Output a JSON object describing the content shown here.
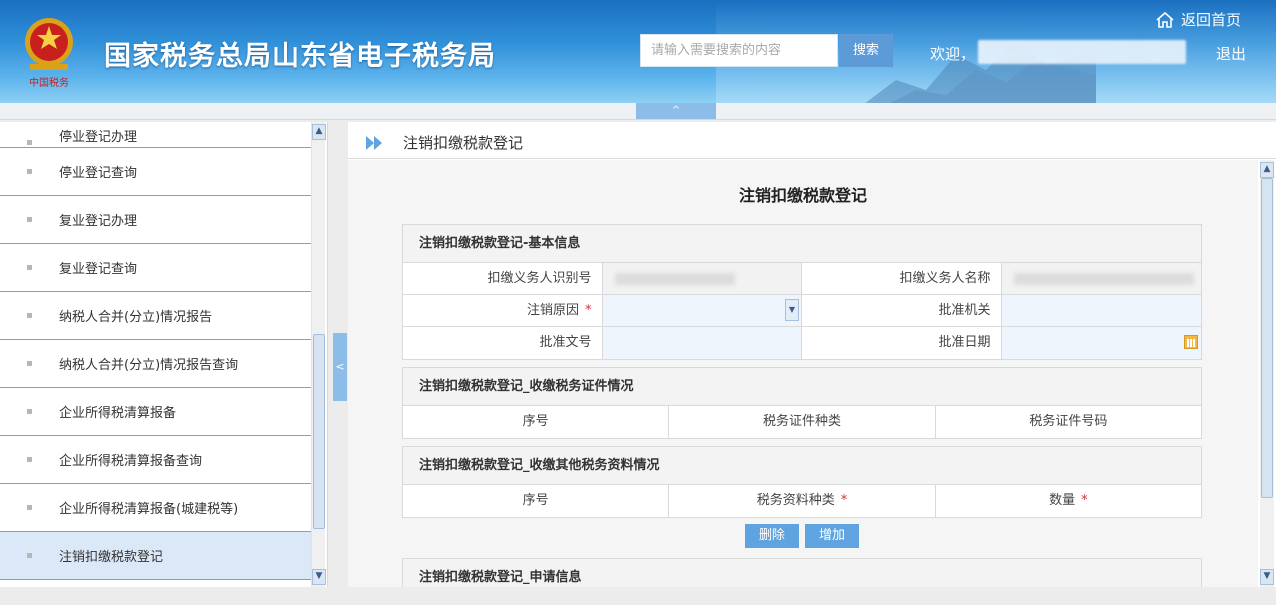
{
  "header": {
    "site_title": "国家税务总局山东省电子税务局",
    "search_placeholder": "请输入需要搜索的内容",
    "search_button": "搜索",
    "welcome": "欢迎，",
    "logout": "退出",
    "home": "返回首页",
    "collapse_tab": "^"
  },
  "sidebar": {
    "toggle": "<",
    "items": [
      {
        "label": "停业登记办理"
      },
      {
        "label": "停业登记查询"
      },
      {
        "label": "复业登记办理"
      },
      {
        "label": "复业登记查询"
      },
      {
        "label": "纳税人合并(分立)情况报告"
      },
      {
        "label": "纳税人合并(分立)情况报告查询"
      },
      {
        "label": "企业所得税清算报备"
      },
      {
        "label": "企业所得税清算报备查询"
      },
      {
        "label": "企业所得税清算报备(城建税等)"
      },
      {
        "label": "注销扣缴税款登记"
      }
    ]
  },
  "breadcrumb": "注销扣缴税款登记",
  "form": {
    "title": "注销扣缴税款登记",
    "basic": {
      "heading": "注销扣缴税款登记-基本信息",
      "withholder_id_label": "扣缴义务人识别号",
      "withholder_name_label": "扣缴义务人名称",
      "reason_label": "注销原因",
      "approval_org_label": "批准机关",
      "approval_doc_label": "批准文号",
      "approval_date_label": "批准日期",
      "required_mark": "*"
    },
    "certs": {
      "heading": "注销扣缴税款登记_收缴税务证件情况",
      "col_seq": "序号",
      "col_type": "税务证件种类",
      "col_number": "税务证件号码"
    },
    "other": {
      "heading": "注销扣缴税款登记_收缴其他税务资料情况",
      "col_seq": "序号",
      "col_type": "税务资料种类",
      "col_qty": "数量",
      "required_mark": "*"
    },
    "buttons": {
      "delete": "删除",
      "add": "增加"
    },
    "apply": {
      "heading": "注销扣缴税款登记_申请信息"
    }
  },
  "colors": {
    "header_blue": "#2f8fd8",
    "button_blue": "#5fa4e0",
    "active_item": "#dbe8f7",
    "required": "#e03030"
  }
}
